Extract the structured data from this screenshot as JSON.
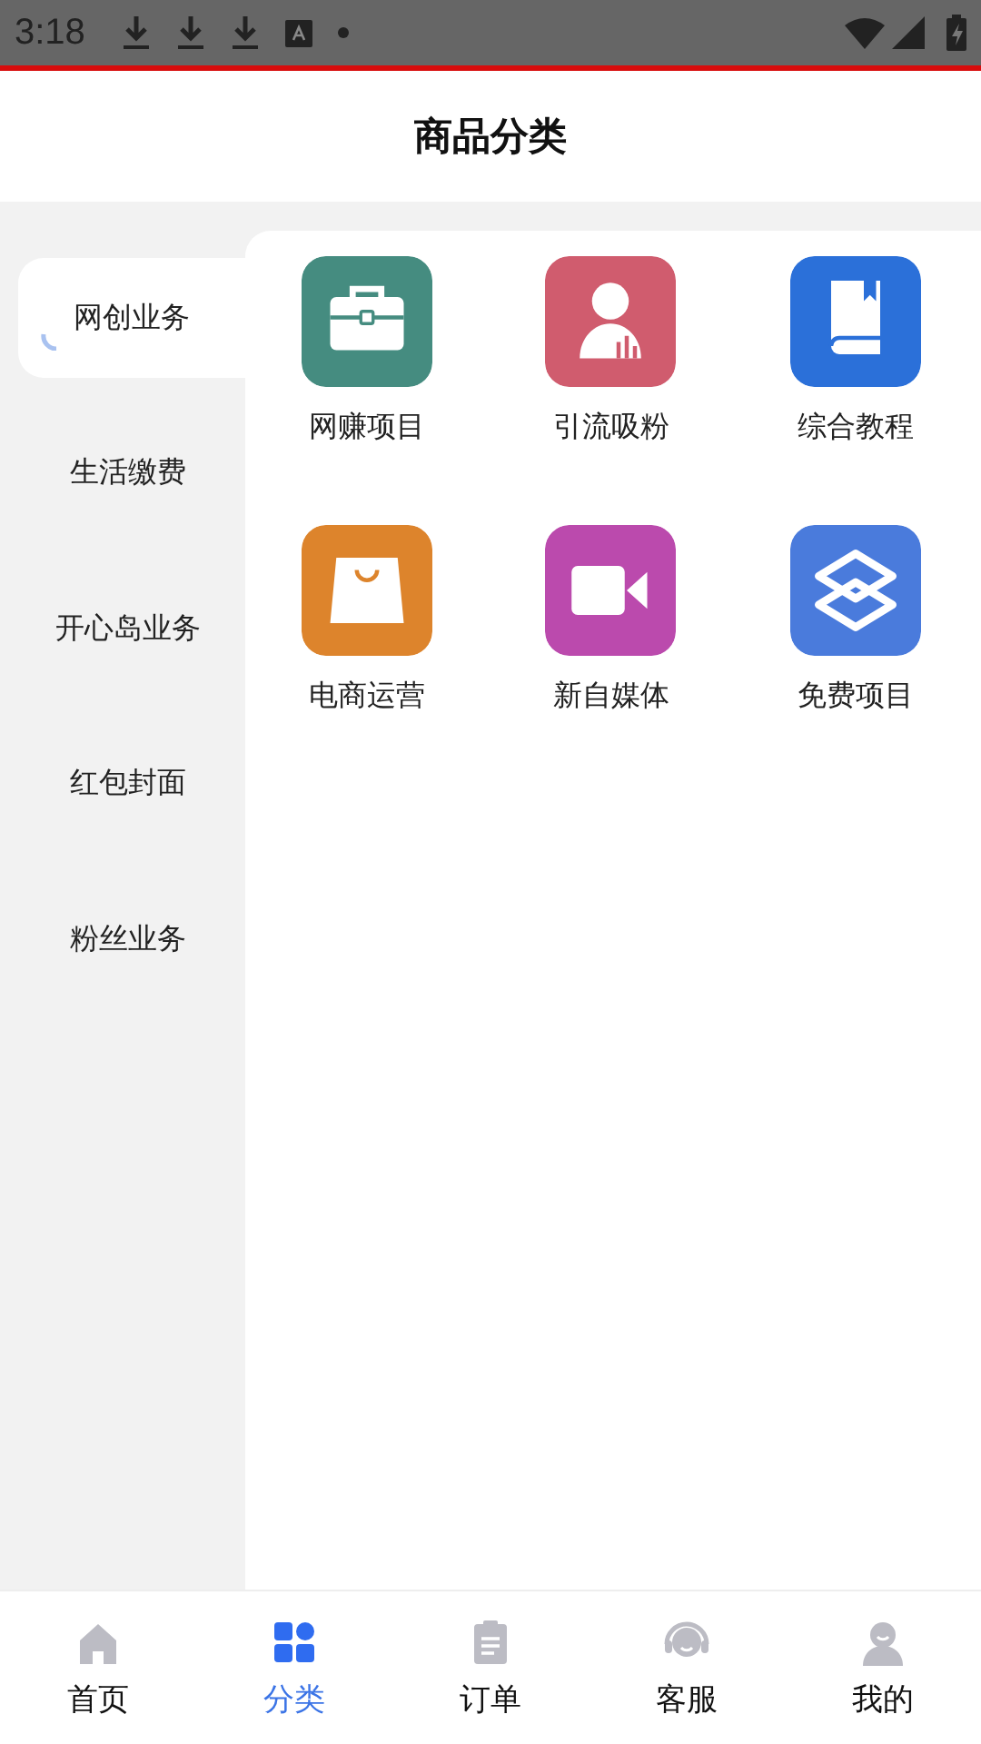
{
  "status_bar": {
    "time": "3:18"
  },
  "header": {
    "title": "商品分类"
  },
  "sidebar": {
    "items": [
      {
        "label": "网创业务",
        "selected": true
      },
      {
        "label": "生活缴费",
        "selected": false
      },
      {
        "label": "开心岛业务",
        "selected": false
      },
      {
        "label": "红包封面",
        "selected": false
      },
      {
        "label": "粉丝业务",
        "selected": false
      }
    ]
  },
  "grid": {
    "items": [
      {
        "label": "网赚项目",
        "color": "#458c80"
      },
      {
        "label": "引流吸粉",
        "color": "#d05c6e"
      },
      {
        "label": "综合教程",
        "color": "#2b70d9"
      },
      {
        "label": "电商运营",
        "color": "#dd842c"
      },
      {
        "label": "新自媒体",
        "color": "#bb4aad"
      },
      {
        "label": "免费项目",
        "color": "#4a7bdc"
      }
    ]
  },
  "tab_bar": {
    "tabs": [
      {
        "label": "首页",
        "selected": false
      },
      {
        "label": "分类",
        "selected": true
      },
      {
        "label": "订单",
        "selected": false
      },
      {
        "label": "客服",
        "selected": false
      },
      {
        "label": "我的",
        "selected": false
      }
    ]
  }
}
